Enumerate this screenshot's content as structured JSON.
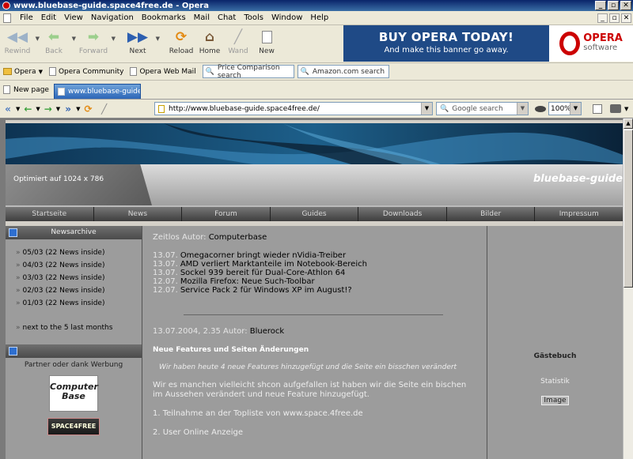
{
  "window": {
    "title": "www.bluebase-guide.space4free.de - Opera"
  },
  "menu": [
    "File",
    "Edit",
    "View",
    "Navigation",
    "Bookmarks",
    "Mail",
    "Chat",
    "Tools",
    "Window",
    "Help"
  ],
  "toolbar": {
    "rewind": "Rewind",
    "back": "Back",
    "forward": "Forward",
    "next": "Next",
    "reload": "Reload",
    "home": "Home",
    "wand": "Wand",
    "new": "New"
  },
  "banner": {
    "headline": "BUY OPERA TODAY!",
    "sub": "And make this banner go away.",
    "brand": "OPERA",
    "brand_sub": "software"
  },
  "bookmarks": {
    "opera": "Opera",
    "community": "Opera Community",
    "webmail": "Opera Web Mail",
    "price_search": "Price Comparison search",
    "amazon_search": "Amazon.com search"
  },
  "tabs": {
    "new_page": "New page",
    "active": "www.bluebase-guide.spac..."
  },
  "address": {
    "url": "http://www.bluebase-guide.space4free.de/",
    "search_placeholder": "Google search",
    "zoom": "100%"
  },
  "site": {
    "optimized": "Optimiert auf 1024 x 786",
    "brand": "bluebase-guide",
    "nav": [
      "Startseite",
      "News",
      "Forum",
      "Guides",
      "Downloads",
      "Bilder",
      "Impressum"
    ],
    "archive_title": "Newsarchive",
    "archive": [
      "05/03 (22 News inside)",
      "04/03 (22 News inside)",
      "03/03 (22 News inside)",
      "02/03 (22 News inside)",
      "01/03 (22 News inside)"
    ],
    "next_link": "next to the 5 last months",
    "partner": "Partner oder dank Werbung",
    "logo1": "Computer Base",
    "logo2": "SPACE4FREE",
    "zeitlos_label": "Zeitlos Autor:",
    "zeitlos_author": "Computerbase",
    "news": [
      {
        "date": "13.07.",
        "text": "Omegacorner bringt wieder nVidia-Treiber"
      },
      {
        "date": "13.07.",
        "text": "AMD verliert Marktanteile im Notebook-Bereich"
      },
      {
        "date": "13.07.",
        "text": "Sockel 939 bereit für Dual-Core-Athlon 64"
      },
      {
        "date": "12.07.",
        "text": "Mozilla Firefox: Neue Such-Toolbar"
      },
      {
        "date": "12.07.",
        "text": "Service Pack 2 für Windows XP im August!?"
      }
    ],
    "post_meta": "13.07.2004, 2.35 Autor:",
    "post_author": "Bluerock",
    "post_title": "Neue Features und Seiten Änderungen",
    "post_intro": "Wir haben heute 4 neue Features hinzugefügt und die Seite ein bisschen verändert",
    "post_body": "Wir es manchen vielleicht shcon aufgefallen ist haben wir die Seite ein bischen im Aussehen verändert und neue Feature hinzugefügt.",
    "post_item1": "1. Teilnahme an der Topliste von www.space.4free.de",
    "post_item2": "2. User Online Anzeige",
    "guestbook": "Gästebuch",
    "statistik": "Statistik",
    "image": "Image"
  }
}
